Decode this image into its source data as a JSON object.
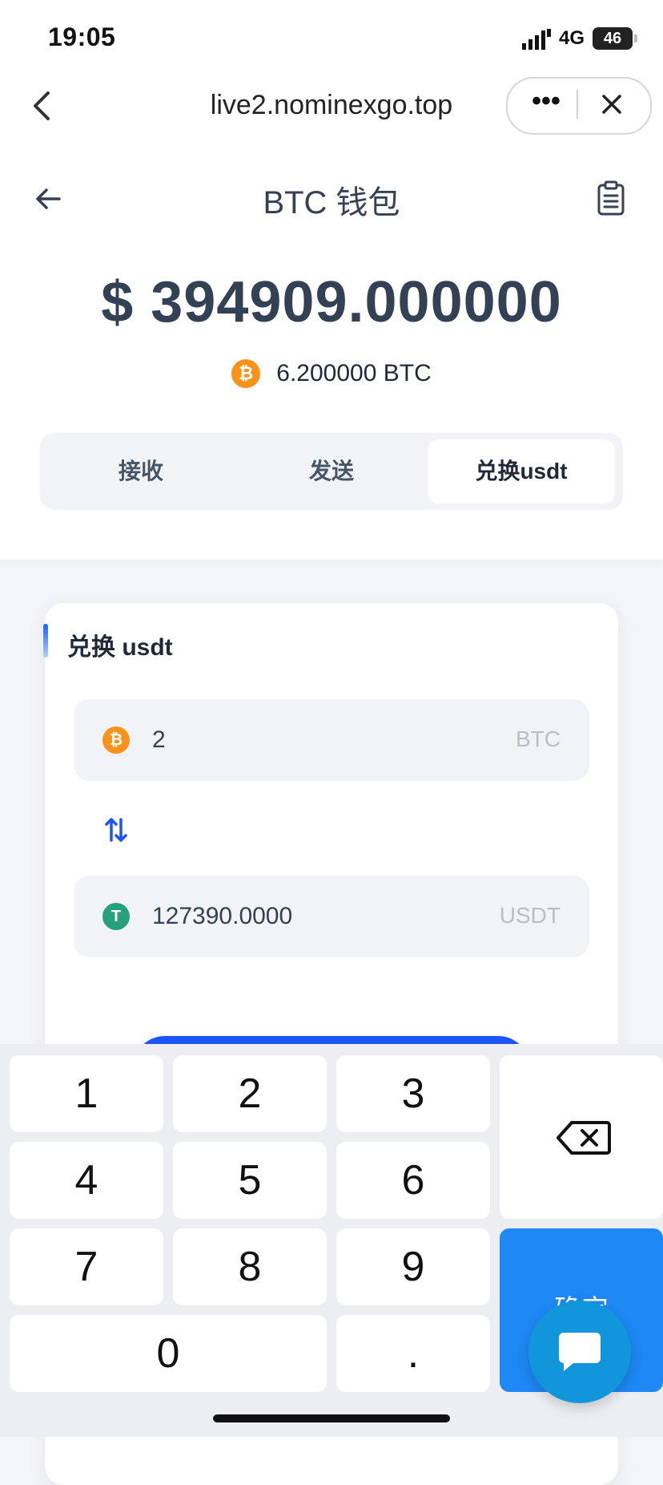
{
  "status_bar": {
    "time": "19:05",
    "network": "4G",
    "battery": "46"
  },
  "browser": {
    "url": "live2.nominexgo.top",
    "more_label": "•••"
  },
  "header": {
    "title": "BTC 钱包"
  },
  "wallet": {
    "balance_usd": "$ 394909.000000",
    "btc_balance": "6.200000 BTC",
    "btc_symbol": "₿"
  },
  "tabs": [
    {
      "label": "接收",
      "active": false
    },
    {
      "label": "发送",
      "active": false
    },
    {
      "label": "兑换usdt",
      "active": true
    }
  ],
  "exchange": {
    "title": "兑换 usdt",
    "from": {
      "value": "2",
      "unit": "BTC",
      "icon_text": "₿"
    },
    "to": {
      "value": "127390.0000",
      "unit": "USDT",
      "icon_text": "T"
    }
  },
  "keyboard": {
    "keys": [
      "1",
      "2",
      "3",
      "4",
      "5",
      "6",
      "7",
      "8",
      "9",
      "0",
      "."
    ],
    "confirm_label": "确定"
  },
  "colors": {
    "accent": "#1d54f5",
    "btc": "#f7931a",
    "usdt": "#26a17b",
    "confirm_key": "#1e88f5",
    "chat_fab": "#1296db"
  },
  "icons": {
    "back": "chevron-left-icon",
    "close": "close-icon",
    "arrow_back": "arrow-left-icon",
    "record": "clipboard-icon",
    "swap": "swap-vertical-icon",
    "delete": "backspace-icon",
    "chat": "chat-bubble-icon"
  }
}
